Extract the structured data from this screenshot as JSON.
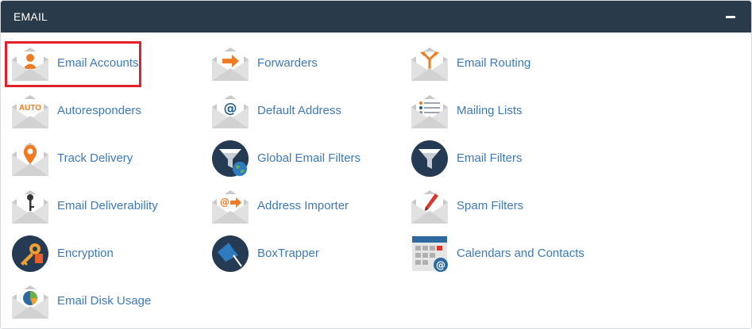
{
  "panel": {
    "title": "EMAIL",
    "collapse_icon": "minus-icon",
    "header_color": "#293a4a",
    "link_color": "#3d7ab8",
    "highlight_color": "#e0212b"
  },
  "items": [
    {
      "label": "Email Accounts",
      "icon": "email-accounts-icon"
    },
    {
      "label": "Forwarders",
      "icon": "forwarders-icon"
    },
    {
      "label": "Email Routing",
      "icon": "email-routing-icon"
    },
    {
      "label": "Autoresponders",
      "icon": "autoresponders-icon",
      "icon_text": "AUTO"
    },
    {
      "label": "Default Address",
      "icon": "default-address-icon"
    },
    {
      "label": "Mailing Lists",
      "icon": "mailing-lists-icon"
    },
    {
      "label": "Track Delivery",
      "icon": "track-delivery-icon"
    },
    {
      "label": "Global Email Filters",
      "icon": "global-email-filters-icon"
    },
    {
      "label": "Email Filters",
      "icon": "email-filters-icon"
    },
    {
      "label": "Email Deliverability",
      "icon": "email-deliverability-icon"
    },
    {
      "label": "Address Importer",
      "icon": "address-importer-icon"
    },
    {
      "label": "Spam Filters",
      "icon": "spam-filters-icon"
    },
    {
      "label": "Encryption",
      "icon": "encryption-icon"
    },
    {
      "label": "BoxTrapper",
      "icon": "boxtrapper-icon"
    },
    {
      "label": "Calendars and Contacts",
      "icon": "calendars-contacts-icon"
    },
    {
      "label": "Email Disk Usage",
      "icon": "email-disk-usage-icon"
    }
  ]
}
